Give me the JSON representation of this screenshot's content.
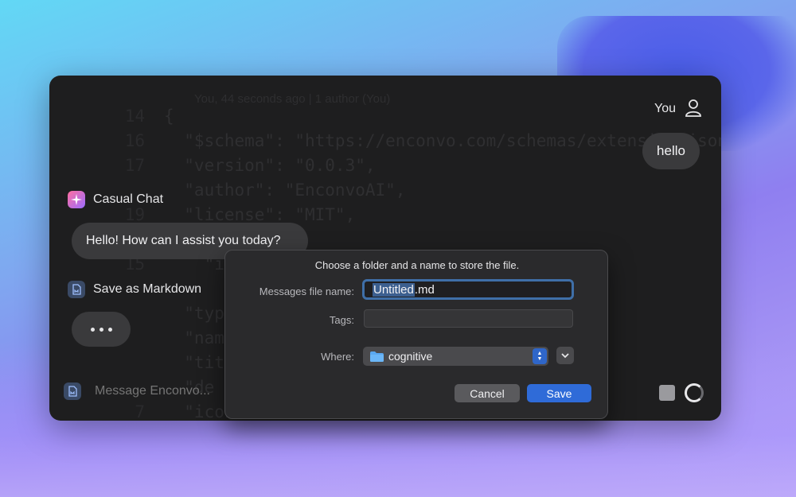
{
  "user": {
    "name": "You",
    "message": "hello"
  },
  "agents": [
    {
      "name": "Casual Chat",
      "icon": "sparkle-icon",
      "message": "Hello! How can I assist you today?"
    },
    {
      "name": "Save as Markdown",
      "icon": "document-icon"
    }
  ],
  "composer": {
    "placeholder": "Message Enconvo..."
  },
  "background_code": {
    "blame": "You, 44 seconds ago | 1 author (You)",
    "lines": [
      {
        "num": "14",
        "text": "{"
      },
      {
        "num": "16",
        "text": "  \"$schema\": \"https://enconvo.com/schemas/extension.json\","
      },
      {
        "num": "17",
        "text": "  \"version\": \"0.0.3\","
      },
      {
        "num": "",
        "text": "  \"author\": \"EnconvoAI\","
      },
      {
        "num": "19",
        "text": "  \"license\": \"MIT\","
      },
      {
        "num": "",
        "text": ""
      },
      {
        "num": "15",
        "text": "    \"i"
      },
      {
        "num": "",
        "text": ""
      },
      {
        "num": "",
        "text": "  \"type"
      },
      {
        "num": "",
        "text": "  \"name"
      },
      {
        "num": "",
        "text": "  \"titl"
      },
      {
        "num": "",
        "text": "  \"de"
      },
      {
        "num": "7",
        "text": "  \"icon"
      }
    ]
  },
  "dialog": {
    "title": "Choose a folder and a name to store the  file.",
    "file_name_label": "Messages file name:",
    "file_name_selected": "Untitled",
    "file_name_ext": ".md",
    "tags_label": "Tags:",
    "where_label": "Where:",
    "where_value": "cognitive",
    "cancel_label": "Cancel",
    "save_label": "Save"
  },
  "colors": {
    "window_bg": "#1e1e1f",
    "bubble_bg": "#3a3a3c",
    "accent_blue": "#2f6bd8",
    "folder_blue": "#5aa8f0"
  }
}
